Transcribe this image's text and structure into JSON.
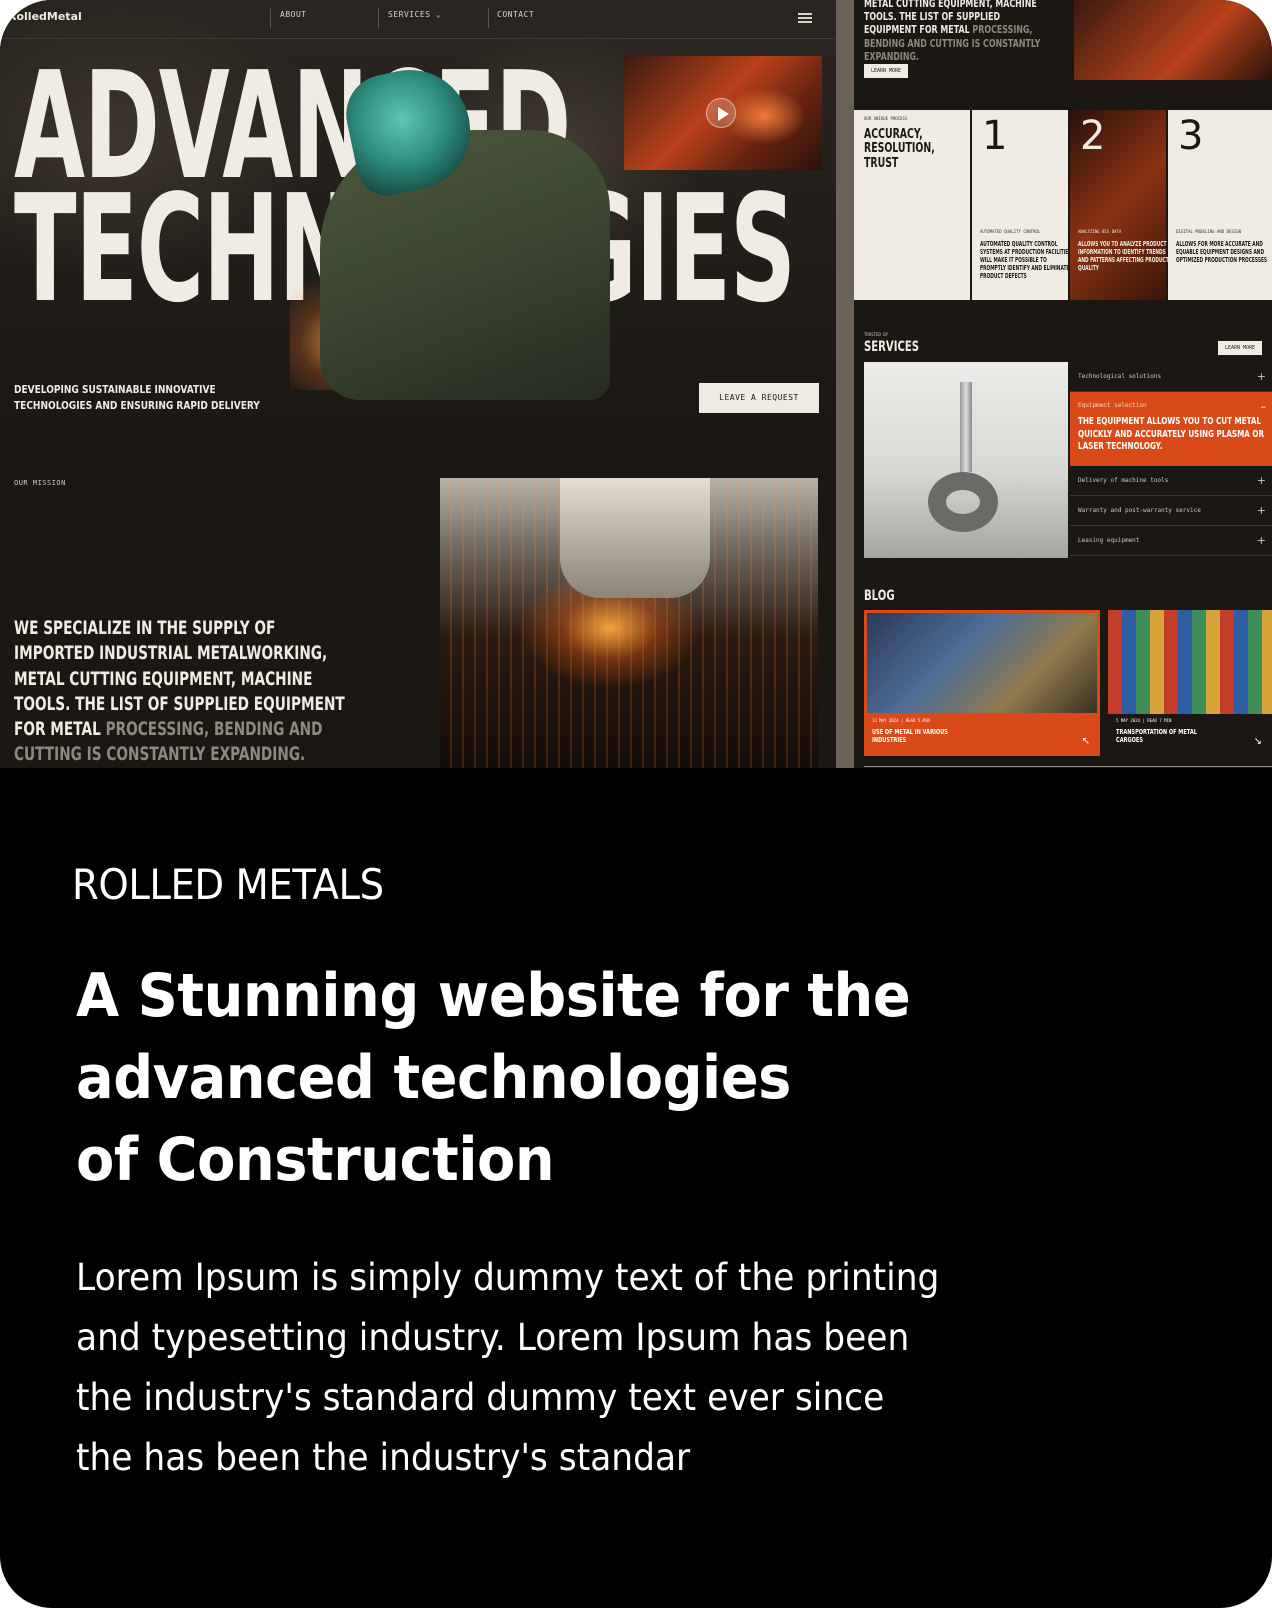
{
  "preview": {
    "nav": {
      "logo": "RolledMetal",
      "about": "ABOUT",
      "services": "SERVICES",
      "contact": "CONTACT"
    },
    "hero": {
      "title_line1": "ADVANCED",
      "title_line2": "TECHNOLOGIES",
      "subtitle_line1": "DEVELOPING SUSTAINABLE INNOVATIVE",
      "subtitle_line2": "TECHNOLOGIES AND ENSURING RAPID DELIVERY",
      "cta": "LEAVE A REQUEST"
    },
    "mission": {
      "label": "OUR MISSION",
      "text_bright": "WE SPECIALIZE IN THE SUPPLY OF IMPORTED INDUSTRIAL METALWORKING, METAL CUTTING EQUIPMENT, MACHINE TOOLS. THE LIST OF SUPPLIED EQUIPMENT FOR METAL",
      "text_dim": "PROCESSING, BENDING AND CUTTING IS CONSTANTLY EXPANDING."
    },
    "right_page": {
      "top_text_bright": "METAL CUTTING EQUIPMENT, MACHINE TOOLS. THE LIST OF SUPPLIED EQUIPMENT FOR METAL",
      "top_text_dim": "PROCESSING, BENDING AND CUTTING IS CONSTANTLY EXPANDING.",
      "learn_more": "LEARN MORE",
      "process": {
        "small_label": "OUR UNIQUE PROCESS",
        "title": "ACCURACY, RESOLUTION, TRUST",
        "steps": [
          {
            "num": "1",
            "label": "AUTOMATED QUALITY CONTROL",
            "desc": "AUTOMATED QUALITY CONTROL SYSTEMS AT PRODUCTION FACILITIES WILL MAKE IT POSSIBLE TO PROMPTLY IDENTIFY AND ELIMINATE PRODUCT DEFECTS"
          },
          {
            "num": "2",
            "label": "ANALYZING BIG DATA",
            "desc": "ALLOWS YOU TO ANALYZE PRODUCT INFORMATION TO IDENTIFY TRENDS AND PATTERNS AFFECTING PRODUCT QUALITY"
          },
          {
            "num": "3",
            "label": "DIGITAL MODELING AND DESIGN",
            "desc": "ALLOWS FOR MORE ACCURATE AND EQUABLE EQUIPMENT DESIGNS AND OPTIMIZED PRODUCTION PROCESSES"
          }
        ]
      },
      "services": {
        "small_label": "TRUSTED BY",
        "title": "SERVICES",
        "learn_more": "LEARN MORE",
        "items": [
          {
            "label": "Technological solutions"
          },
          {
            "label": "Equipment selection",
            "desc": "THE EQUIPMENT ALLOWS YOU TO CUT METAL QUICKLY AND ACCURATELY USING PLASMA OR LASER TECHNOLOGY."
          },
          {
            "label": "Delivery of machine tools"
          },
          {
            "label": "Warranty and post-warranty service"
          },
          {
            "label": "Leasing equipment"
          }
        ]
      },
      "blog": {
        "title": "BLOG",
        "posts": [
          {
            "meta": "13 MAY 2024 | READ 5 MIN",
            "caption": "USE OF METAL IN VARIOUS INDUSTRIES"
          },
          {
            "meta": "5 MAY 2024 | READ 7 MIN",
            "caption": "TRANSPORTATION OF METAL CARGOES"
          }
        ]
      }
    }
  },
  "brand": "ROLLED METALS",
  "headline": {
    "line1": "A Stunning website for the",
    "line2": "advanced technologies",
    "line3": "of Construction"
  },
  "body": {
    "line1": "Lorem Ipsum is simply dummy text of the printing",
    "line2": "and typesetting industry. Lorem Ipsum has been",
    "line3": "the industry's standard dummy text ever since",
    "line4": "the has been the industry's standar"
  },
  "colors": {
    "accent": "#d94a18",
    "cream": "#f1ece3",
    "dark": "#1b1814",
    "card_bg": "#000000"
  }
}
